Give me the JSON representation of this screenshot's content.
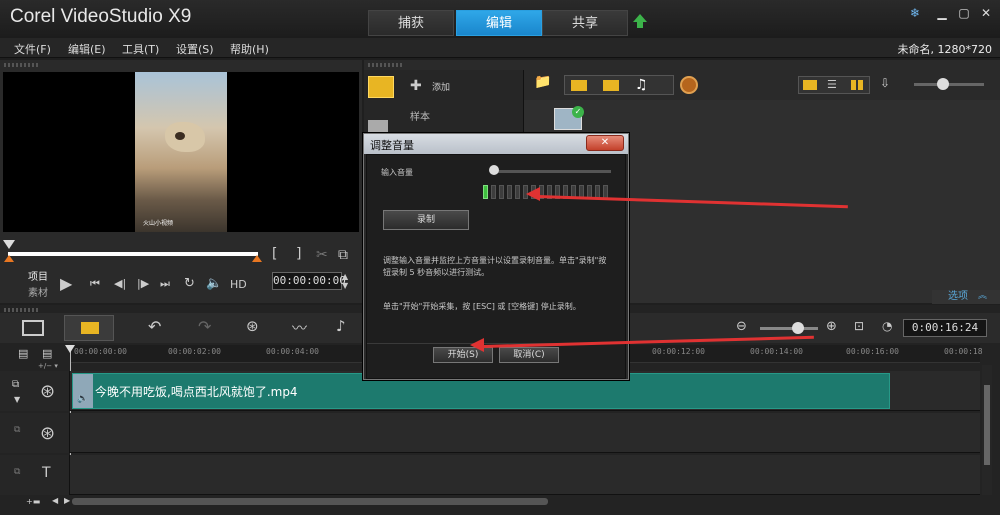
{
  "app": {
    "title": "Corel VideoStudio X9",
    "tabs": [
      "捕获",
      "编辑",
      "共享"
    ],
    "active_tab": "编辑",
    "project_info": "未命名, 1280*720"
  },
  "menu": [
    "文件(F)",
    "编辑(E)",
    "工具(T)",
    "设置(S)",
    "帮助(H)"
  ],
  "preview": {
    "mode_project": "项目",
    "mode_clip": "素材",
    "hd_label": "HD",
    "timecode": "00:00:00:00",
    "watermark": "火山小视频",
    "bracket_in": "[",
    "bracket_out": "]"
  },
  "library": {
    "add_label": "添加",
    "item_sample": "样本",
    "options_label": "选项"
  },
  "timeline": {
    "duration": "0:00:16:24",
    "ticks": [
      "00:00:00:00",
      "00:00:02:00",
      "00:00:04:00",
      "00:00:12:00",
      "00:00:14:00",
      "00:00:16:00",
      "00:00:18"
    ],
    "clip_name": "今晚不用吃饭,喝点西北风就饱了.mp4"
  },
  "dialog": {
    "title": "调整音量",
    "input_volume_label": "输入音量",
    "record_button": "录制",
    "instructions": "调整输入音量并监控上方音量计以设置录制音量。单击\"录制\"按钮录制 5 秒音频以进行测试。",
    "start_hint": "单击\"开始\"开始采集，按 [ESC] 或 [空格键] 停止录制。",
    "start_button": "开始(S)",
    "cancel_button": "取消(C)",
    "close_label": "✕",
    "meter_level": 0.06
  },
  "colors": {
    "accent": "#1a86cc",
    "clip": "#1d7a6e",
    "annotation": "#e03232"
  }
}
